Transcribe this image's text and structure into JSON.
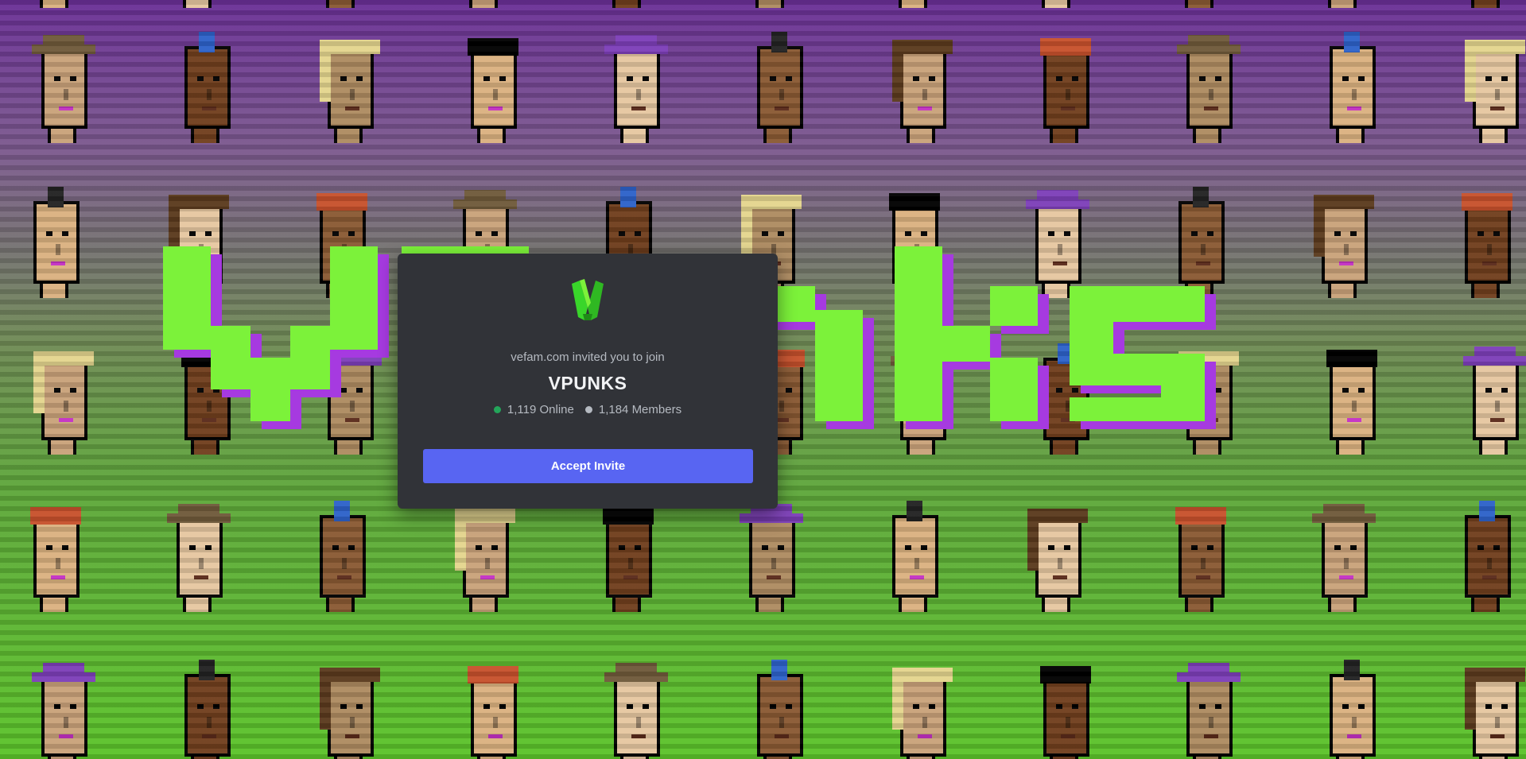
{
  "invite": {
    "inviter_text": "vefam.com invited you to join",
    "server_name": "VPUNKS",
    "online_count": "1,119 Online",
    "member_count": "1,184 Members",
    "accept_label": "Accept Invite"
  },
  "background": {
    "wordmark_text": "VPUNKS",
    "wordmark_color": "#7cf23a",
    "wordmark_shadow_color": "#a63ae0",
    "top_color": "#6a2f96",
    "bottom_color": "#5cc42a"
  },
  "colors": {
    "card_bg": "#313338",
    "accent": "#5865f2",
    "online_dot": "#23a55a",
    "members_dot": "#b5bac1",
    "logo_green": "#39d62a"
  },
  "icons": {
    "server_logo": "vpunks-v-logo-icon",
    "online": "online-dot-icon",
    "members": "members-dot-icon"
  }
}
